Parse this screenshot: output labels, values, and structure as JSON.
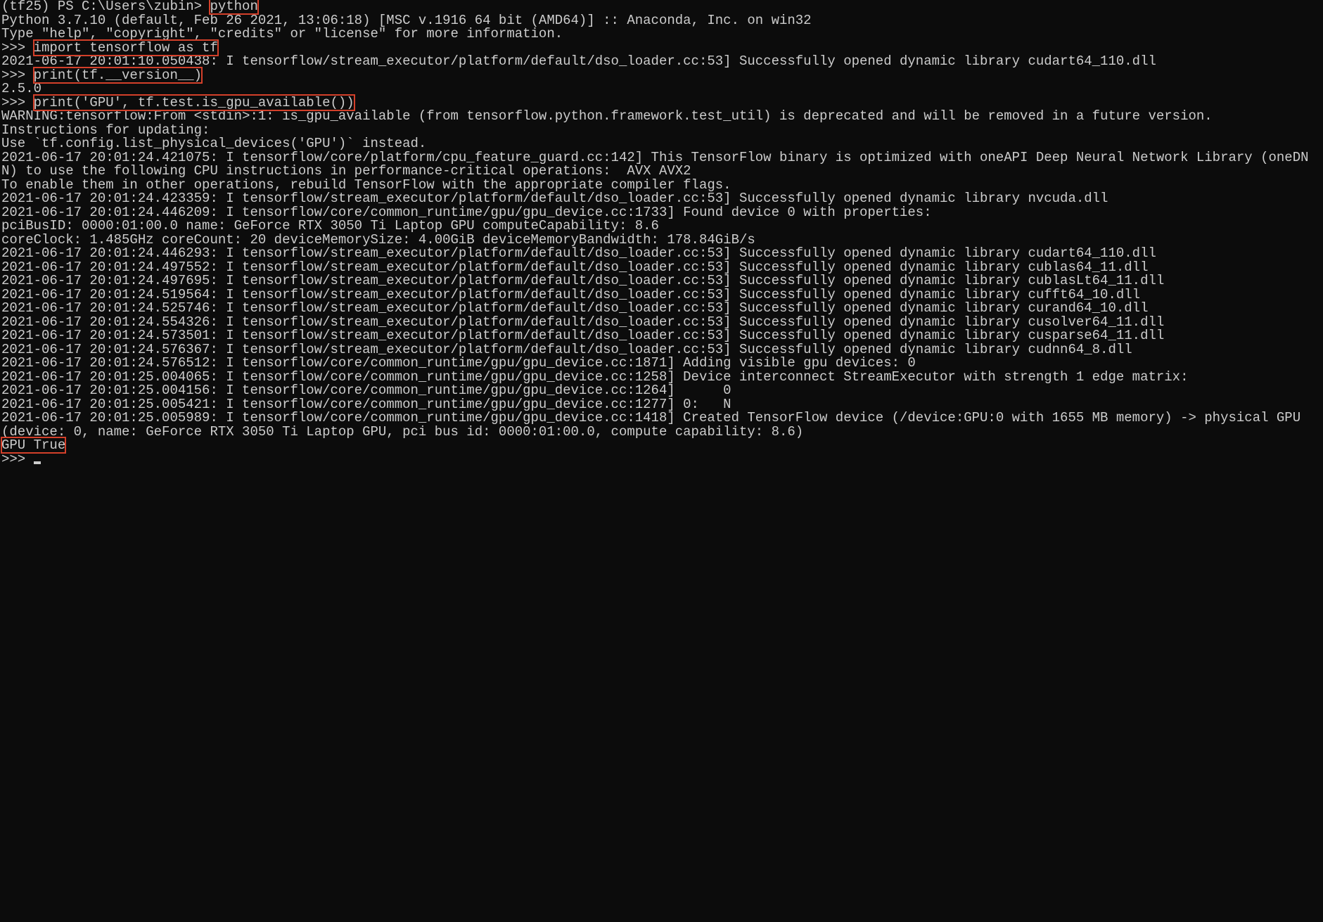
{
  "prompt_prefix": "(tf25) PS C:\\Users\\zubin> ",
  "cmd_python": "python",
  "python_banner1": "Python 3.7.10 (default, Feb 26 2021, 13:06:18) [MSC v.1916 64 bit (AMD64)] :: Anaconda, Inc. on win32",
  "python_banner2": "Type \"help\", \"copyright\", \"credits\" or \"license\" for more information.",
  "repl": ">>> ",
  "cmd_import_tf": "import tensorflow as tf",
  "log_dso_1": "2021-06-17 20:01:10.050438: I tensorflow/stream_executor/platform/default/dso_loader.cc:53] Successfully opened dynamic library cudart64_110.dll",
  "cmd_print_version": "print(tf.__version__)",
  "tf_version": "2.5.0",
  "cmd_print_gpu": "print('GPU', tf.test.is_gpu_available())",
  "warn1": "WARNING:tensorflow:From <stdin>:1: is_gpu_available (from tensorflow.python.framework.test_util) is deprecated and will be removed in a future version.",
  "warn2": "Instructions for updating:",
  "warn3": "Use `tf.config.list_physical_devices('GPU')` instead.",
  "log_cpu_guard": "2021-06-17 20:01:24.421075: I tensorflow/core/platform/cpu_feature_guard.cc:142] This TensorFlow binary is optimized with oneAPI Deep Neural Network Library (oneDNN) to use the following CPU instructions in performance-critical operations:  AVX AVX2",
  "log_cpu_guard2": "To enable them in other operations, rebuild TensorFlow with the appropriate compiler flags.",
  "log_nvcuda": "2021-06-17 20:01:24.423359: I tensorflow/stream_executor/platform/default/dso_loader.cc:53] Successfully opened dynamic library nvcuda.dll",
  "log_found_device": "2021-06-17 20:01:24.446209: I tensorflow/core/common_runtime/gpu/gpu_device.cc:1733] Found device 0 with properties:",
  "log_device_name": "pciBusID: 0000:01:00.0 name: GeForce RTX 3050 Ti Laptop GPU computeCapability: 8.6",
  "log_device_clock": "coreClock: 1.485GHz coreCount: 20 deviceMemorySize: 4.00GiB deviceMemoryBandwidth: 178.84GiB/s",
  "log_cudart2": "2021-06-17 20:01:24.446293: I tensorflow/stream_executor/platform/default/dso_loader.cc:53] Successfully opened dynamic library cudart64_110.dll",
  "log_cublas": "2021-06-17 20:01:24.497552: I tensorflow/stream_executor/platform/default/dso_loader.cc:53] Successfully opened dynamic library cublas64_11.dll",
  "log_cublaslt": "2021-06-17 20:01:24.497695: I tensorflow/stream_executor/platform/default/dso_loader.cc:53] Successfully opened dynamic library cublasLt64_11.dll",
  "log_cufft": "2021-06-17 20:01:24.519564: I tensorflow/stream_executor/platform/default/dso_loader.cc:53] Successfully opened dynamic library cufft64_10.dll",
  "log_curand": "2021-06-17 20:01:24.525746: I tensorflow/stream_executor/platform/default/dso_loader.cc:53] Successfully opened dynamic library curand64_10.dll",
  "log_cusolver": "2021-06-17 20:01:24.554326: I tensorflow/stream_executor/platform/default/dso_loader.cc:53] Successfully opened dynamic library cusolver64_11.dll",
  "log_cusparse": "2021-06-17 20:01:24.573501: I tensorflow/stream_executor/platform/default/dso_loader.cc:53] Successfully opened dynamic library cusparse64_11.dll",
  "log_cudnn": "2021-06-17 20:01:24.576367: I tensorflow/stream_executor/platform/default/dso_loader.cc:53] Successfully opened dynamic library cudnn64_8.dll",
  "log_visible_gpu": "2021-06-17 20:01:24.576512: I tensorflow/core/common_runtime/gpu/gpu_device.cc:1871] Adding visible gpu devices: 0",
  "log_interconnect": "2021-06-17 20:01:25.004065: I tensorflow/core/common_runtime/gpu/gpu_device.cc:1258] Device interconnect StreamExecutor with strength 1 edge matrix:",
  "log_matrix1": "2021-06-17 20:01:25.004156: I tensorflow/core/common_runtime/gpu/gpu_device.cc:1264]      0",
  "log_matrix2": "2021-06-17 20:01:25.005421: I tensorflow/core/common_runtime/gpu/gpu_device.cc:1277] 0:   N",
  "log_created_device": "2021-06-17 20:01:25.005989: I tensorflow/core/common_runtime/gpu/gpu_device.cc:1418] Created TensorFlow device (/device:GPU:0 with 1655 MB memory) -> physical GPU (device: 0, name: GeForce RTX 3050 Ti Laptop GPU, pci bus id: 0000:01:00.0, compute capability: 8.6)",
  "result_gpu": "GPU True"
}
